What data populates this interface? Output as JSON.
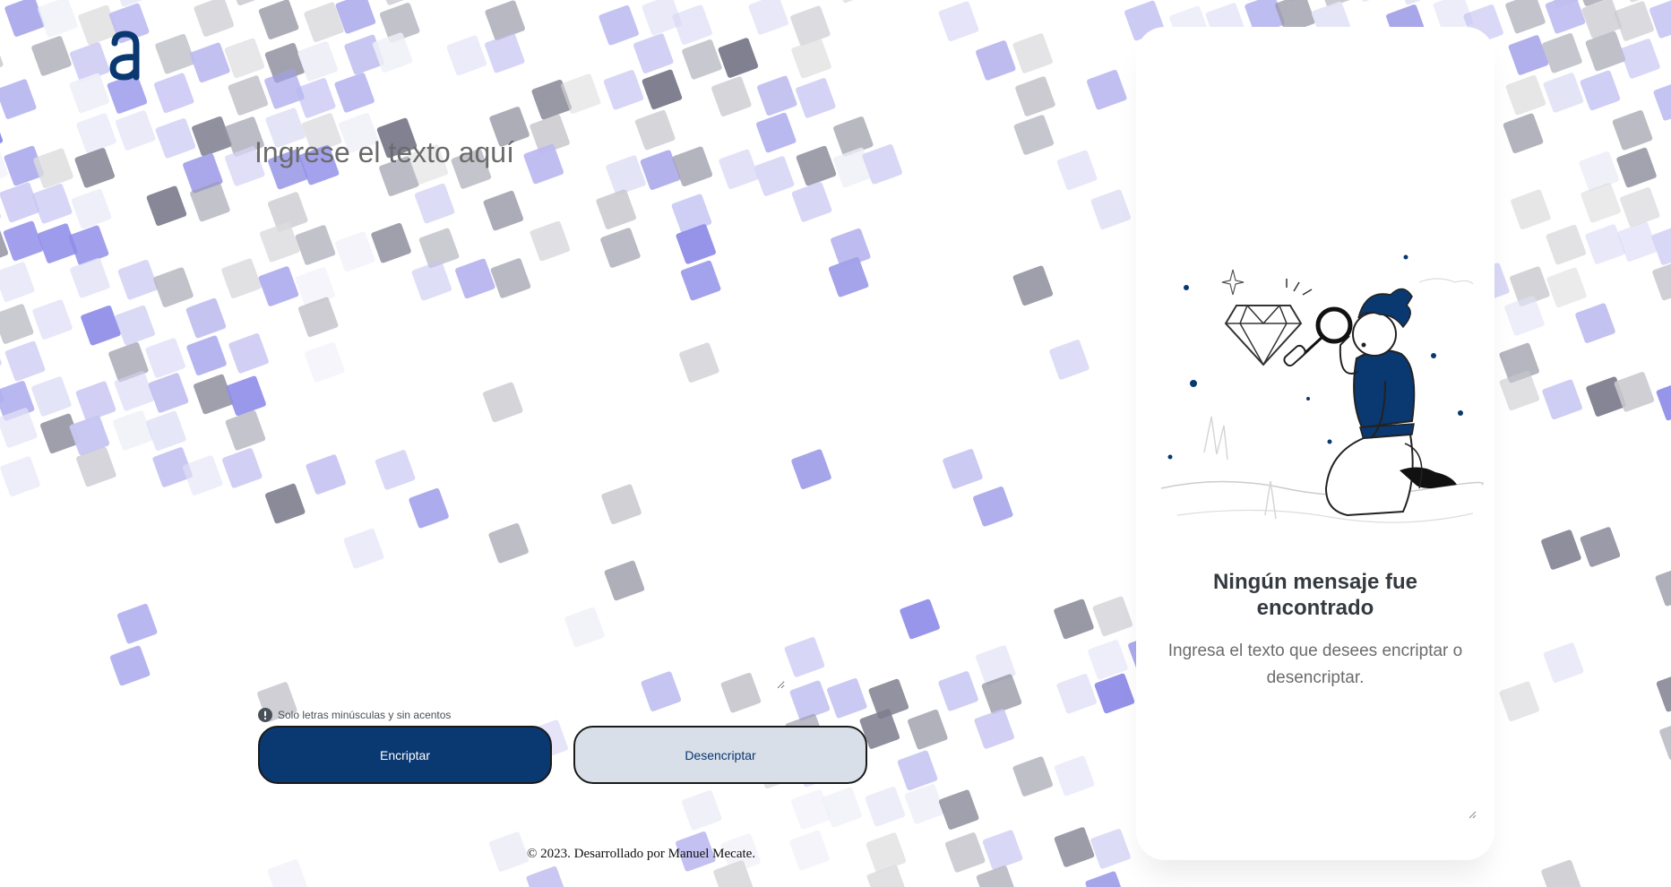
{
  "app": {
    "logo_letter": "a"
  },
  "input": {
    "placeholder": "Ingrese el texto aquí",
    "value": ""
  },
  "hint": {
    "icon": "exclamation-circle-icon",
    "text": "Solo letras minúsculas y sin acentos"
  },
  "buttons": {
    "encrypt_label": "Encriptar",
    "decrypt_label": "Desencriptar"
  },
  "result_panel": {
    "title": "Ningún mensaje fue encontrado",
    "subtitle": "Ingresa el texto que desees encriptar o desencriptar.",
    "illustration": "person-with-magnifying-glass-looking-at-diamond"
  },
  "footer": {
    "text": "© 2023. Desarrollado por Manuel Mecate."
  },
  "colors": {
    "primary": "#0a3871",
    "secondary_button": "#d8dfe8",
    "tile_purple": "#8f8de8",
    "tile_gray": "#8c8c8c"
  }
}
